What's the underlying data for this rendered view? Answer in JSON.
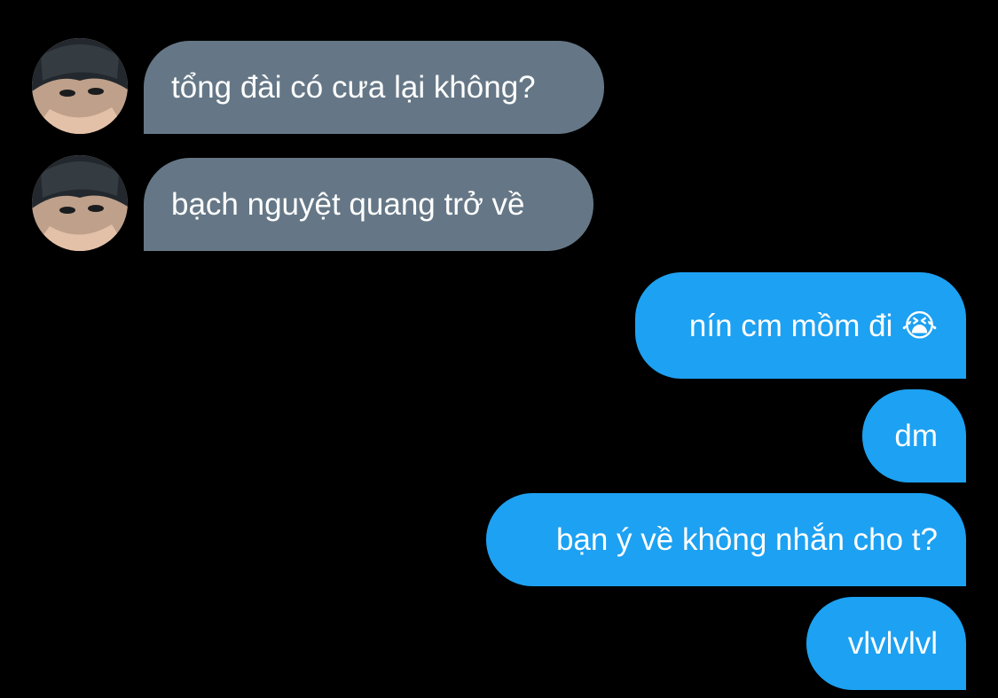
{
  "conversation": {
    "messages": [
      {
        "direction": "incoming",
        "text": "tổng đài có cưa lại không?",
        "avatar_icon": "user-avatar"
      },
      {
        "direction": "incoming",
        "text": "bạch nguyệt quang trở về",
        "avatar_icon": "user-avatar"
      },
      {
        "direction": "outgoing",
        "text": "nín cm mồm đi 😭"
      },
      {
        "direction": "outgoing",
        "text": "dm"
      },
      {
        "direction": "outgoing",
        "text": "bạn ý về không nhắn cho t?"
      },
      {
        "direction": "outgoing",
        "text": "vlvlvlvl"
      }
    ]
  },
  "colors": {
    "background": "#000000",
    "incoming_bubble": "#657786",
    "outgoing_bubble": "#1da1f2",
    "text": "#ffffff"
  }
}
